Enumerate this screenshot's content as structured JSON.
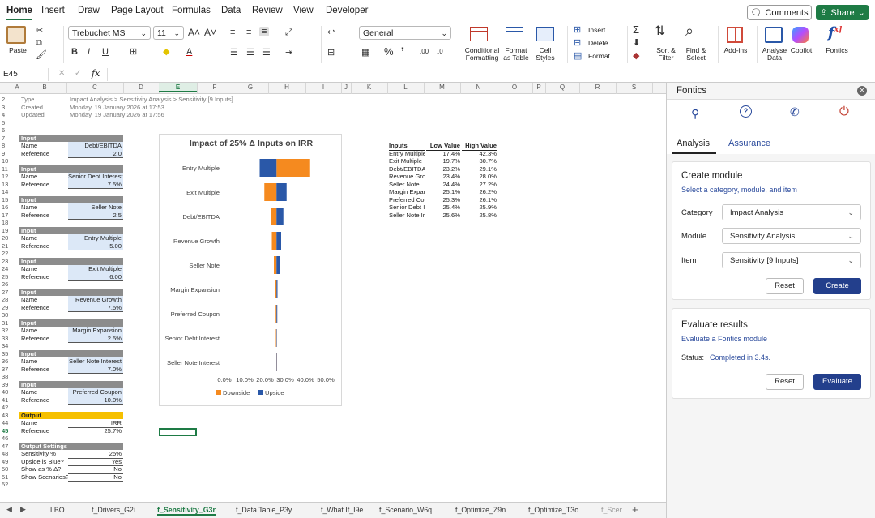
{
  "menu": {
    "tabs": [
      "Home",
      "Insert",
      "Draw",
      "Page Layout",
      "Formulas",
      "Data",
      "Review",
      "View",
      "Developer"
    ],
    "comments": "Comments",
    "share": "Share"
  },
  "ribbon": {
    "paste": "Paste",
    "font": "Trebuchet MS",
    "size": "11",
    "format": "General",
    "conditional": [
      "Conditional",
      "Formatting"
    ],
    "format_table": [
      "Format",
      "as Table"
    ],
    "cell_styles": [
      "Cell",
      "Styles"
    ],
    "insert": "Insert",
    "delete": "Delete",
    "format_cells": "Format",
    "sort": [
      "Sort &",
      "Filter"
    ],
    "find": [
      "Find &",
      "Select"
    ],
    "addins": "Add-ins",
    "analyse": [
      "Analyse",
      "Data"
    ],
    "copilot": "Copilot",
    "fontics": "Fontics",
    "bold": "B",
    "italic": "I",
    "underline": "U",
    "sigma": "Σ",
    "percent": "%",
    "comma": "❜",
    "decimals": [
      ".00",
      ".0"
    ]
  },
  "formula_bar": {
    "cell": "E45",
    "fx": "fx",
    "value": ""
  },
  "columns": [
    "A",
    "B",
    "C",
    "D",
    "E",
    "F",
    "G",
    "H",
    "I",
    "J",
    "K",
    "L",
    "M",
    "N",
    "O",
    "P",
    "Q",
    "R",
    "S"
  ],
  "meta": [
    {
      "k": "Type",
      "v": "Impact Analysis > Sensitivity Analysis > Sensitivity [9 Inputs]"
    },
    {
      "k": "Created",
      "v": "Monday, 19 January 2026 at 17:53"
    },
    {
      "k": "Updated",
      "v": "Monday, 19 January 2026 at 17:56"
    }
  ],
  "inputs": [
    {
      "header": "Input",
      "name": "Debt/EBITDA",
      "ref": "2.0"
    },
    {
      "header": "Input",
      "name": "Senior Debt Interest",
      "ref": "7.5%"
    },
    {
      "header": "Input",
      "name": "Seller Note",
      "ref": "2.5"
    },
    {
      "header": "Input",
      "name": "Entry Multiple",
      "ref": "5.00"
    },
    {
      "header": "Input",
      "name": "Exit Multiple",
      "ref": "6.00"
    },
    {
      "header": "Input",
      "name": "Revenue Growth",
      "ref": "7.5%"
    },
    {
      "header": "Input",
      "name": "Margin Expansion",
      "ref": "2.5%"
    },
    {
      "header": "Input",
      "name": "Seller Note Interest",
      "ref": "7.0%"
    },
    {
      "header": "Input",
      "name": "Preferred Coupon",
      "ref": "10.0%"
    }
  ],
  "output": {
    "header": "Output",
    "name": "IRR",
    "ref": "25.7%"
  },
  "labels": {
    "name": "Name",
    "reference": "Reference"
  },
  "settings": {
    "header": "Output Settings",
    "rows": [
      {
        "k": "Sensitivity %",
        "v": "25%"
      },
      {
        "k": "Upside is Blue?",
        "v": "Yes"
      },
      {
        "k": "Show as % Δ?",
        "v": "No"
      },
      {
        "k": "Show Scenarios?",
        "v": "No"
      }
    ]
  },
  "table": {
    "headers": [
      "Inputs",
      "Low Value",
      "High Value"
    ],
    "rows": [
      [
        "Entry Multiple",
        "17.4%",
        "42.3%"
      ],
      [
        "Exit Multiple",
        "19.7%",
        "30.7%"
      ],
      [
        "Debt/EBITDA",
        "23.2%",
        "29.1%"
      ],
      [
        "Revenue Growth",
        "23.4%",
        "28.0%"
      ],
      [
        "Seller Note",
        "24.4%",
        "27.2%"
      ],
      [
        "Margin Expansion",
        "25.1%",
        "26.2%"
      ],
      [
        "Preferred Coupon",
        "25.3%",
        "26.1%"
      ],
      [
        "Senior Debt Interest",
        "25.4%",
        "25.9%"
      ],
      [
        "Seller Note Interest",
        "25.6%",
        "25.8%"
      ]
    ]
  },
  "chart_data": {
    "type": "bar",
    "orientation": "horizontal",
    "title": "Impact of 25% Δ Inputs on IRR",
    "categories": [
      "Entry Multiple",
      "Exit Multiple",
      "Debt/EBITDA",
      "Revenue Growth",
      "Seller Note",
      "Margin Expansion",
      "Preferred Coupon",
      "Senior Debt Interest",
      "Seller Note Interest"
    ],
    "base": 25.7,
    "series": [
      {
        "name": "Downside",
        "color": "#f58a1f",
        "values": [
          42.3,
          19.7,
          23.2,
          23.4,
          24.4,
          25.1,
          25.3,
          25.4,
          25.6
        ]
      },
      {
        "name": "Upside",
        "color": "#2a58a8",
        "values": [
          17.4,
          30.7,
          29.1,
          28.0,
          27.2,
          26.2,
          26.1,
          25.9,
          25.8
        ]
      }
    ],
    "xticks": [
      "0.0%",
      "10.0%",
      "20.0%",
      "30.0%",
      "40.0%",
      "50.0%"
    ],
    "xlim": [
      0,
      50
    ],
    "legend": "bottom"
  },
  "sheets": [
    "LBO",
    "f_Drivers_G2i",
    "f_Sensitivity_G3r",
    "f_Data Table_P3y",
    "f_What If_I9e",
    "f_Scenario_W6q",
    "f_Optimize_Z9n",
    "f_Optimize_T3o",
    "f_Scen"
  ],
  "active_sheet": "f_Sensitivity_G3r",
  "pane": {
    "title": "Fontics",
    "tabs": [
      "Analysis",
      "Assurance"
    ],
    "create": {
      "title": "Create module",
      "subtitle": "Select a category, module, and item",
      "category_label": "Category",
      "category": "Impact Analysis",
      "module_label": "Module",
      "module": "Sensitivity Analysis",
      "item_label": "Item",
      "item": "Sensitivity [9 Inputs]",
      "reset": "Reset",
      "create": "Create"
    },
    "evaluate": {
      "title": "Evaluate results",
      "subtitle": "Evaluate a Fontics module",
      "status_label": "Status:",
      "status": "Completed in 3.4s.",
      "reset": "Reset",
      "evaluate": "Evaluate"
    }
  }
}
